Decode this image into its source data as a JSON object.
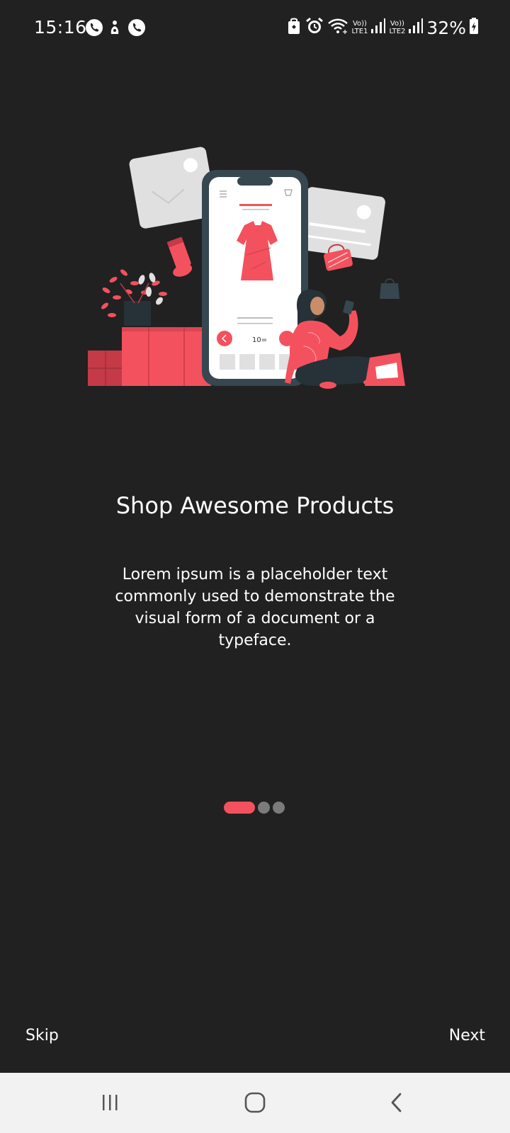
{
  "status_bar": {
    "time": "15:16",
    "battery_percent": "32%",
    "sim1_label_top": "Vo))",
    "sim1_label_bottom": "LTE1",
    "sim2_label_top": "Vo))",
    "sim2_label_bottom": "LTE2",
    "icons_left": [
      "phone-call-icon",
      "notification-icon",
      "phone-call-icon"
    ],
    "icons_right": [
      "lock-icon",
      "alarm-icon",
      "wifi-icon",
      "signal-icon",
      "signal-icon",
      "battery-charging-icon"
    ]
  },
  "illustration": {
    "price_label": "10="
  },
  "onboarding": {
    "title": "Shop Awesome Products",
    "description": "Lorem ipsum is a placeholder text commonly used to demonstrate the visual form of a document or a typeface.",
    "page_current": 1,
    "page_total": 3
  },
  "actions": {
    "skip_label": "Skip",
    "next_label": "Next"
  },
  "colors": {
    "background": "#212121",
    "accent": "#f4515e",
    "inactive_dot": "#7b7b7b",
    "nav_bar": "#f2f2f2"
  }
}
